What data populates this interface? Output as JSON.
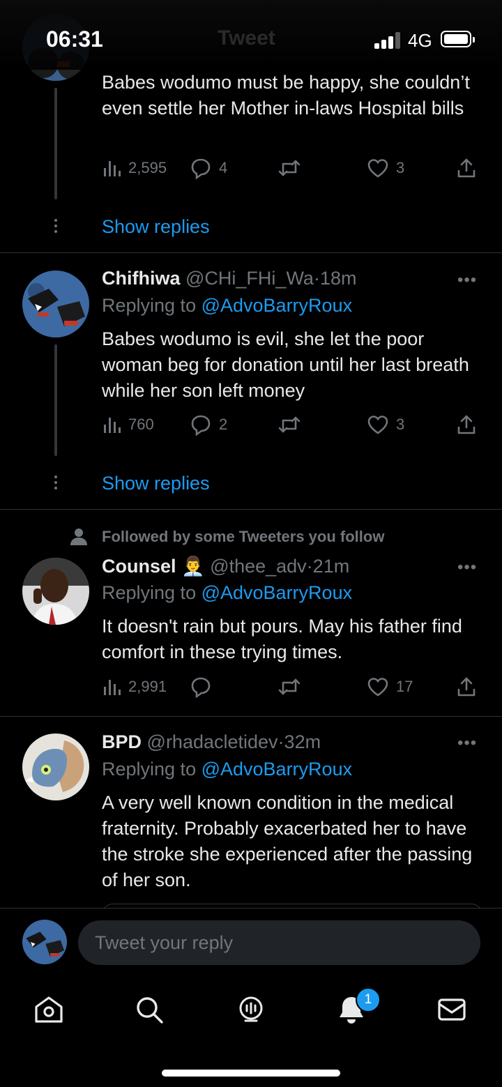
{
  "status_bar": {
    "time": "06:31",
    "network": "4G",
    "ghost_title": "Tweet"
  },
  "tweets": [
    {
      "body": "Babes wodumo must be happy, she couldn’t even settle her Mother in-laws Hospital bills",
      "stats": {
        "views": "2,595",
        "replies": "4",
        "retweets": "",
        "likes": "3"
      },
      "show_replies": "Show replies"
    },
    {
      "name": "Chifhiwa",
      "handle": "@CHi_FHi_Wa",
      "dot": "·",
      "age": "18m",
      "replying_prefix": "Replying to ",
      "replying_to": "@AdvoBarryRoux",
      "body": "Babes wodumo is evil, she let the poor woman beg for donation until her last breath while her son left money",
      "stats": {
        "views": "760",
        "replies": "2",
        "retweets": "",
        "likes": "3"
      },
      "show_replies": "Show replies",
      "more": "•••"
    },
    {
      "social_context": "Followed by some Tweeters you follow",
      "name": "Counsel 👨‍💼",
      "handle": "@thee_adv",
      "dot": "·",
      "age": "21m",
      "replying_prefix": "Replying to ",
      "replying_to": "@AdvoBarryRoux",
      "body": "It doesn't rain but pours. May his father find comfort in these trying times.",
      "stats": {
        "views": "2,991",
        "replies": "",
        "retweets": "",
        "likes": "17"
      },
      "more": "•••"
    },
    {
      "name": "BPD",
      "handle": "@rhadacletidev",
      "dot": "·",
      "age": "32m",
      "replying_prefix": "Replying to ",
      "replying_to": "@AdvoBarryRoux",
      "body": "A very well known condition in the medical fraternity. Probably exacerbated her to have the stroke she experienced after the passing of her son.",
      "more": "•••"
    }
  ],
  "reply_bar": {
    "placeholder": "Tweet your reply"
  },
  "tab_bar": {
    "items": [
      {
        "name": "home",
        "icon": "home-icon"
      },
      {
        "name": "search",
        "icon": "search-icon"
      },
      {
        "name": "spaces",
        "icon": "spaces-icon"
      },
      {
        "name": "notifications",
        "icon": "bell-icon",
        "badge": "1"
      },
      {
        "name": "messages",
        "icon": "mail-icon"
      }
    ]
  },
  "colors": {
    "background": "#000000",
    "accent": "#1d9bf0",
    "secondary_text": "#71767b",
    "divider": "#2f3336"
  }
}
